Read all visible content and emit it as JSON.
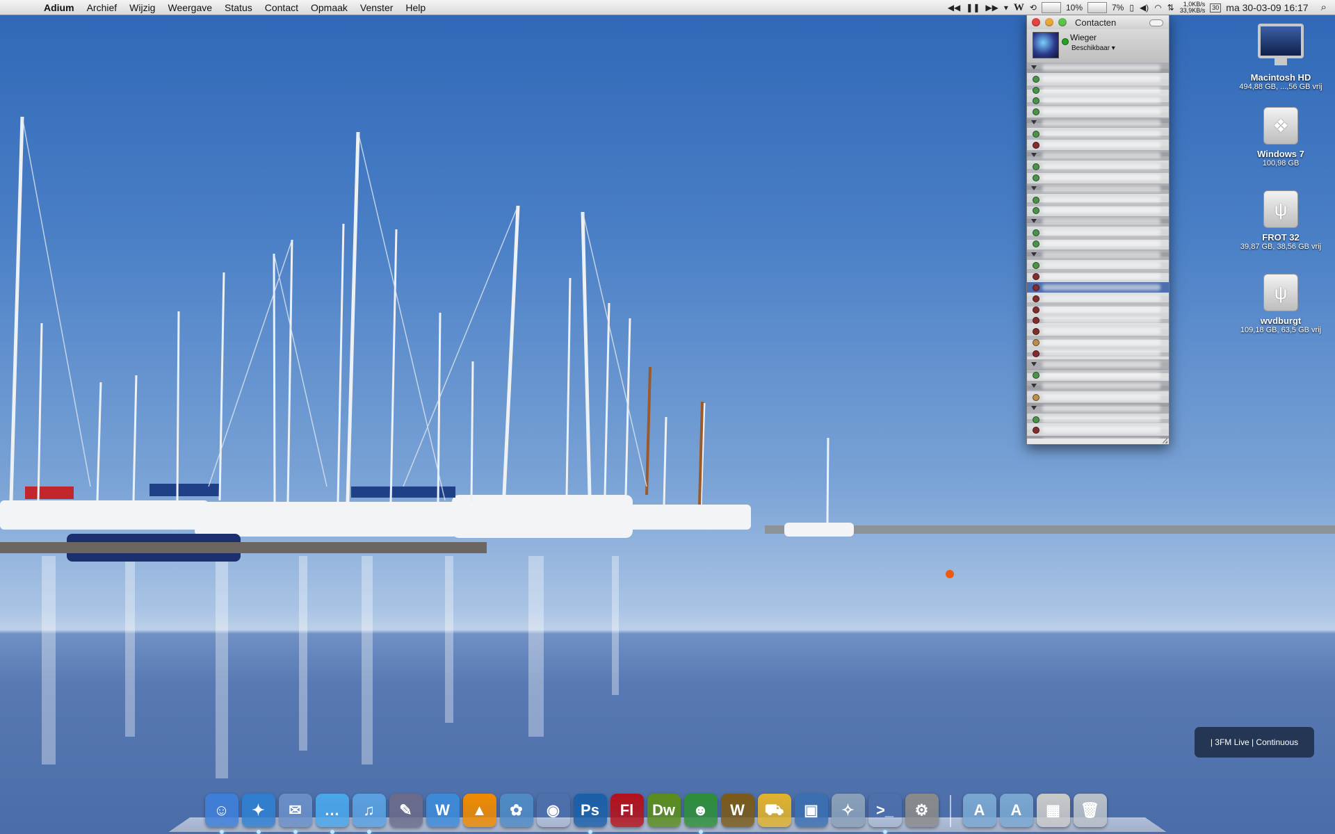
{
  "menubar": {
    "app": "Adium",
    "items": [
      "Archief",
      "Wijzig",
      "Weergave",
      "Status",
      "Contact",
      "Opmaak",
      "Venster",
      "Help"
    ],
    "right": {
      "cpu1": "10%",
      "cpu2": "7%",
      "net_up": "1,0KB/s",
      "net_down": "33,9KB/s",
      "cal_day": "30",
      "clock": "ma 30-03-09 16:17"
    }
  },
  "buddy_list": {
    "title": "Contacten",
    "account_name": "Wieger",
    "account_status": "Beschikbaar"
  },
  "desktop_icons": [
    {
      "label": "Macintosh HD",
      "sub": "494,88 GB, ...,56 GB vrij",
      "icon": "imac-icon"
    },
    {
      "label": "Windows 7",
      "sub": "100,98 GB",
      "icon": "windows-drive-icon"
    },
    {
      "label": "FROT 32",
      "sub": "39,87 GB, 38,56 GB vrij",
      "icon": "usb-drive-icon"
    },
    {
      "label": "wvdburgt",
      "sub": "109,18 GB, 63,5 GB vrij",
      "icon": "usb-drive-icon"
    }
  ],
  "now_playing": "| 3FM Live | Continuous",
  "dock": {
    "apps": [
      {
        "name": "finder",
        "glyph": "☺",
        "color": "#3f7fd8"
      },
      {
        "name": "safari",
        "glyph": "✦",
        "color": "#2f7fd0"
      },
      {
        "name": "mail",
        "glyph": "✉",
        "color": "#6a8fc7"
      },
      {
        "name": "ichat",
        "glyph": "…",
        "color": "#4aa6ea"
      },
      {
        "name": "itunes",
        "glyph": "♫",
        "color": "#5aa0e0"
      },
      {
        "name": "script-editor",
        "glyph": "✎",
        "color": "#6b6b8a"
      },
      {
        "name": "iweb",
        "glyph": "W",
        "color": "#3d8ad8"
      },
      {
        "name": "vlc",
        "glyph": "▲",
        "color": "#f08a00"
      },
      {
        "name": "iphoto",
        "glyph": "✿",
        "color": "#4f8ac4"
      },
      {
        "name": "aperture",
        "glyph": "◉",
        "color": "#333"
      },
      {
        "name": "photoshop",
        "glyph": "Ps",
        "color": "#1b5fa8"
      },
      {
        "name": "flash",
        "glyph": "Fl",
        "color": "#b3111a"
      },
      {
        "name": "dreamweaver",
        "glyph": "Dw",
        "color": "#5a8d1c"
      },
      {
        "name": "adium",
        "glyph": "☻",
        "color": "#2e8e3a"
      },
      {
        "name": "world-of-warcraft",
        "glyph": "W",
        "color": "#7a5a18"
      },
      {
        "name": "transmit",
        "glyph": "⛟",
        "color": "#e1b22c"
      },
      {
        "name": "vmware-fusion",
        "glyph": "▣",
        "color": "#3a6fb0"
      },
      {
        "name": "satellite",
        "glyph": "✧",
        "color": "#8aa0b8"
      },
      {
        "name": "terminal",
        "glyph": ">_",
        "color": "#111"
      },
      {
        "name": "system-preferences",
        "glyph": "⚙",
        "color": "#8a8a8a"
      }
    ],
    "docs": [
      {
        "name": "applications-stack",
        "glyph": "A",
        "color": "#7aa7d1"
      },
      {
        "name": "documents-stack",
        "glyph": "A",
        "color": "#7aa7d1"
      },
      {
        "name": "downloads-stack",
        "glyph": "▦",
        "color": "#c9c9c9"
      },
      {
        "name": "trash",
        "glyph": "🗑",
        "color": "#b9c0c8"
      }
    ]
  },
  "colors": {
    "accent": "#3a6fd9",
    "online": "#27a226",
    "away": "#d98a1b",
    "offline": "#b41f1f"
  }
}
